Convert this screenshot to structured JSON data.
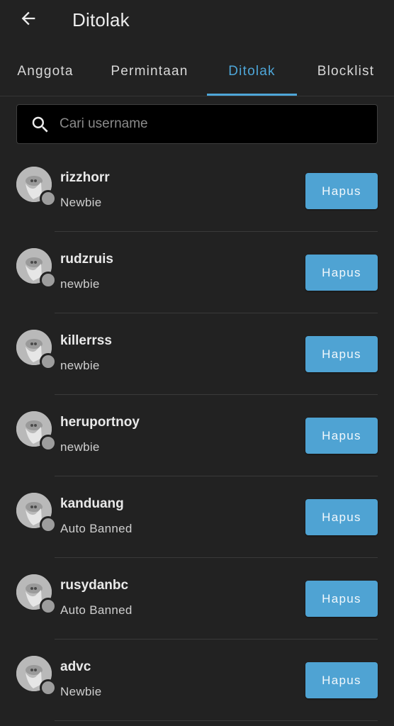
{
  "header": {
    "title": "Ditolak",
    "back_icon": "arrow-left-icon"
  },
  "tabs": [
    {
      "label": "Anggota",
      "active": false
    },
    {
      "label": "Permintaan",
      "active": false
    },
    {
      "label": "Ditolak",
      "active": true
    },
    {
      "label": "Blocklist",
      "active": false
    }
  ],
  "search": {
    "placeholder": "Cari username",
    "value": "",
    "icon": "search-icon"
  },
  "members": [
    {
      "username": "rizzhorr",
      "title": "Newbie",
      "action_label": "Hapus"
    },
    {
      "username": "rudzruis",
      "title": "newbie",
      "action_label": "Hapus"
    },
    {
      "username": "killerrss",
      "title": "newbie",
      "action_label": "Hapus"
    },
    {
      "username": "heruportnoy",
      "title": "newbie",
      "action_label": "Hapus"
    },
    {
      "username": "kanduang",
      "title": "Auto Banned",
      "action_label": "Hapus"
    },
    {
      "username": "rusydanbc",
      "title": "Auto Banned",
      "action_label": "Hapus"
    },
    {
      "username": "advc",
      "title": "Newbie",
      "action_label": "Hapus"
    }
  ],
  "colors": {
    "background": "#222222",
    "accent": "#4ea6d8",
    "button": "#4fa3d3",
    "status_offline": "#9d9d9d"
  }
}
